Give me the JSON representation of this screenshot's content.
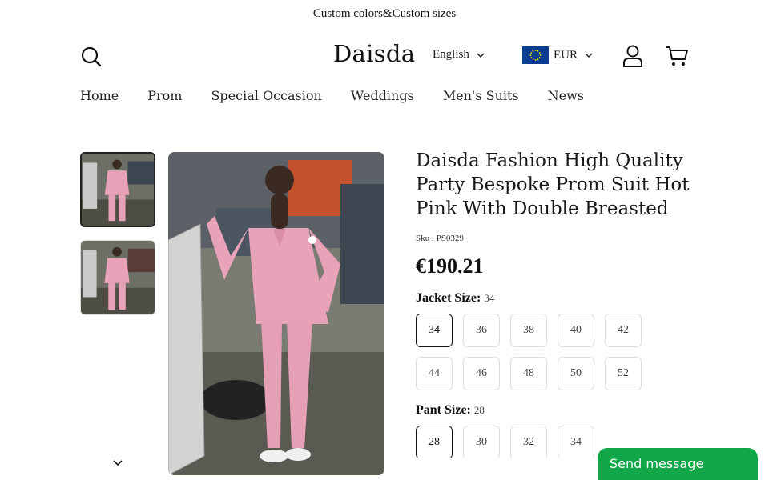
{
  "announcement": "Custom colors&Custom sizes",
  "header": {
    "logo": "Daisda",
    "language": "English",
    "currency": "EUR"
  },
  "nav": {
    "items": [
      {
        "label": "Home"
      },
      {
        "label": "Prom"
      },
      {
        "label": "Special Occasion"
      },
      {
        "label": "Weddings"
      },
      {
        "label": "Men's Suits"
      },
      {
        "label": "News"
      }
    ]
  },
  "product": {
    "title": "Daisda Fashion High Quality Party Bespoke Prom Suit Hot Pink With Double Breasted",
    "sku": "Sku : PS0329",
    "price": "€190.21",
    "jacket": {
      "label": "Jacket Size:",
      "selected": "34",
      "options": [
        "34",
        "36",
        "38",
        "40",
        "42",
        "44",
        "46",
        "48",
        "50",
        "52"
      ]
    },
    "pant": {
      "label": "Pant Size:",
      "selected": "28",
      "options": [
        "28",
        "30",
        "32",
        "34"
      ]
    }
  },
  "chat": {
    "label": "Send message"
  },
  "colors": {
    "suit_pink": "#e9a3b8",
    "chat_green": "#12a84a",
    "flag_blue": "#0b3d91"
  }
}
